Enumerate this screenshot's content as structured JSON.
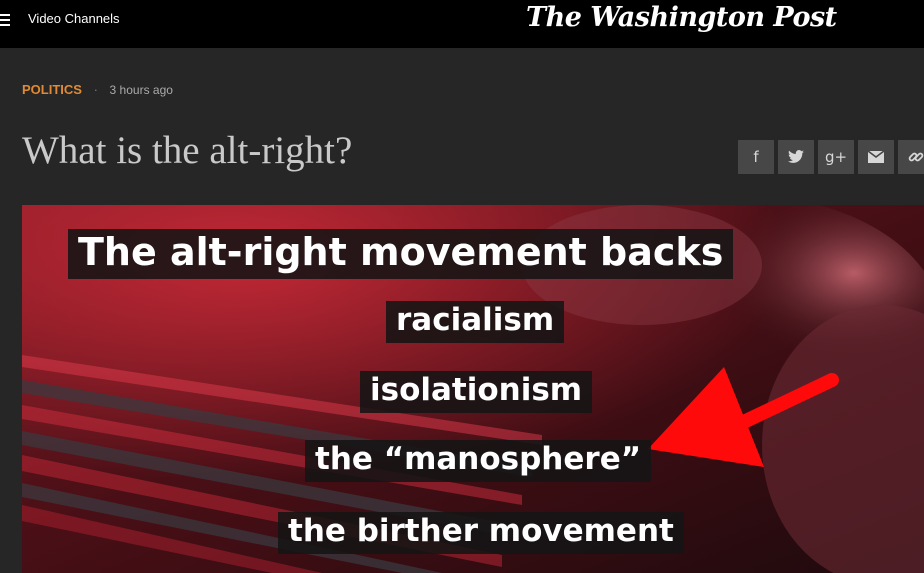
{
  "topbar": {
    "menu_icon": "hamburger-menu-icon",
    "channels_label": "Video Channels",
    "logo_text": "The Washington Post"
  },
  "article": {
    "kicker": "POLITICS",
    "separator": "·",
    "time": "3 hours ago",
    "headline": "What is the alt-right?"
  },
  "share": {
    "facebook": "f",
    "twitter": "🐦",
    "googleplus": "g+",
    "email": "✉",
    "link": "🔗"
  },
  "video": {
    "captions": [
      "The alt-right movement backs",
      "racialism",
      "isolationism",
      "the “manosphere”",
      "the birther movement"
    ],
    "arrow_color": "#ff0a0a"
  }
}
